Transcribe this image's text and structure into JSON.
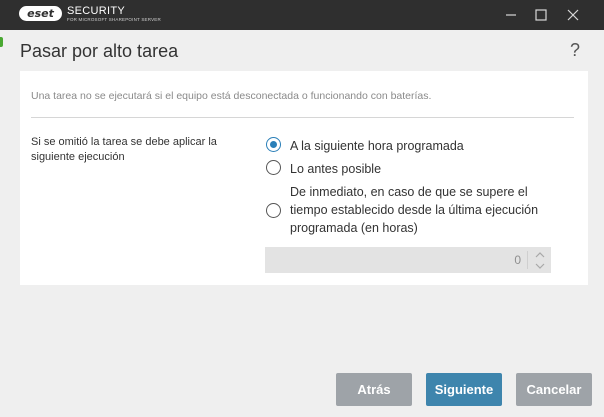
{
  "window": {
    "brand": "eset",
    "product_name": "SECURITY",
    "product_sub": "FOR MICROSOFT SHAREPOINT SERVER"
  },
  "icons": {
    "minimize": "minimize-icon",
    "maximize": "maximize-icon",
    "close": "close-icon",
    "help": "help-icon",
    "step_up": "chevron-up-icon",
    "step_down": "chevron-down-icon"
  },
  "dialog": {
    "title": "Pasar por alto tarea",
    "help": "?",
    "notice": "Una tarea no se ejecutará si el equipo está desconectada o funcionando con baterías.",
    "setting_label": "Si se omitió la tarea se debe aplicar la siguiente ejecución",
    "options": [
      {
        "label": "A la siguiente hora programada",
        "selected": true
      },
      {
        "label": "Lo antes posible",
        "selected": false
      },
      {
        "label": "De inmediato, en caso de que se supere el tiempo establecido desde la última ejecución programada (en horas)",
        "selected": false
      }
    ],
    "hours_value": "0"
  },
  "buttons": {
    "back": "Atrás",
    "next": "Siguiente",
    "cancel": "Cancelar"
  },
  "colors": {
    "accent": "#3e85ad",
    "radio_selected": "#2a7fb8",
    "titlebar": "#2f2f2f",
    "brand_green": "#4aa832",
    "button_disabled": "#9ea3a8"
  }
}
